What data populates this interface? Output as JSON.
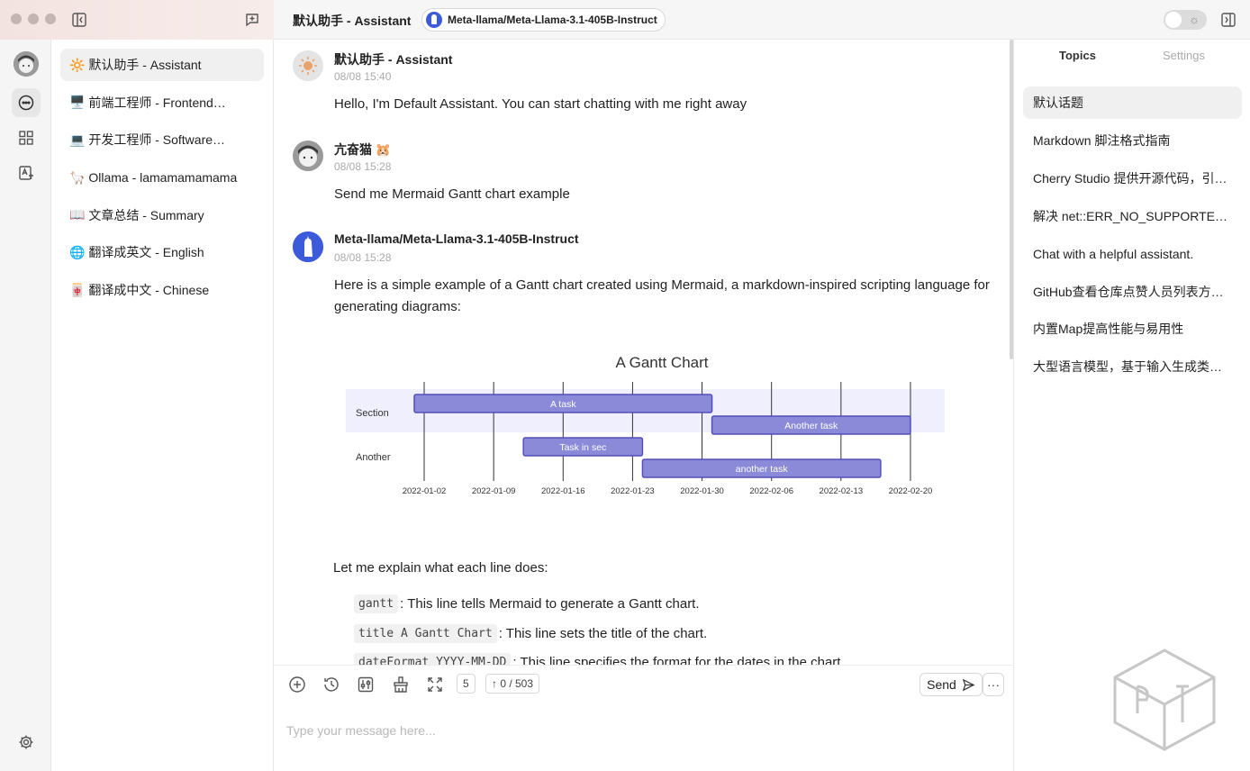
{
  "window": {
    "title": "默认助手 - Assistant",
    "model": "Meta-llama/Meta-Llama-3.1-405B-Instruct"
  },
  "assistants": [
    {
      "emoji": "🔆",
      "label": "默认助手 - Assistant"
    },
    {
      "emoji": "🖥️",
      "label": "前端工程师 - Frontend…"
    },
    {
      "emoji": "💻",
      "label": "开发工程师 - Software…"
    },
    {
      "emoji": "🦙",
      "label": "Ollama - lamamamamama"
    },
    {
      "emoji": "📖",
      "label": "文章总结 - Summary"
    },
    {
      "emoji": "🌐",
      "label": "翻译成英文 - English"
    },
    {
      "emoji": "🀄",
      "label": "翻译成中文 - Chinese"
    }
  ],
  "messages": [
    {
      "name": "默认助手 - Assistant",
      "time": "08/08 15:40",
      "text": "Hello, I'm Default Assistant. You can start chatting with me right away"
    },
    {
      "name": "亢奋猫 🐹",
      "time": "08/08 15:28",
      "text": "Send me Mermaid Gantt chart example"
    },
    {
      "name": "Meta-llama/Meta-Llama-3.1-405B-Instruct",
      "time": "08/08 15:28",
      "text": "Here is a simple example of a Gantt chart created using Mermaid, a markdown-inspired scripting language for generating diagrams:"
    }
  ],
  "chart_data": {
    "type": "gantt",
    "title": "A Gantt Chart",
    "sections": [
      "Section",
      "Another"
    ],
    "tasks": [
      {
        "section": "Section",
        "name": "A task",
        "start": "2022-01-01",
        "end": "2022-01-31"
      },
      {
        "section": "Section",
        "name": "Another task",
        "start": "2022-01-31",
        "end": "2022-02-20"
      },
      {
        "section": "Another",
        "name": "Task in sec",
        "start": "2022-01-12",
        "end": "2022-01-24"
      },
      {
        "section": "Another",
        "name": "another task",
        "start": "2022-01-24",
        "end": "2022-02-17"
      }
    ],
    "x_ticks": [
      "2022-01-02",
      "2022-01-09",
      "2022-01-16",
      "2022-01-23",
      "2022-01-30",
      "2022-02-06",
      "2022-02-13",
      "2022-02-20"
    ],
    "x_range": [
      "2022-01-01",
      "2022-02-20"
    ]
  },
  "explain": {
    "intro": "Let me explain what each line does:",
    "items": [
      {
        "code": "gantt",
        "text": ": This line tells Mermaid to generate a Gantt chart."
      },
      {
        "code": "title A Gantt Chart",
        "text": ": This line sets the title of the chart."
      },
      {
        "code": "dateFormat  YYYY-MM-DD",
        "text": ": This line specifies the format for the dates in the chart."
      }
    ]
  },
  "composer": {
    "context_count": "5",
    "token_count": "↑ 0 / 503",
    "send_label": "Send",
    "placeholder": "Type your message here..."
  },
  "right_panel": {
    "tabs": [
      "Topics",
      "Settings"
    ],
    "topics": [
      "默认话题",
      "Markdown 脚注格式指南",
      "Cherry Studio 提供开源代码，引…",
      "解决 net::ERR_NO_SUPPORTED…",
      "Chat with a helpful assistant.",
      "GitHub查看仓库点赞人员列表方…",
      "内置Map提高性能与易用性",
      "大型语言模型，基于输入生成类…"
    ]
  },
  "colors": {
    "bar_fill": "#8a8ad8",
    "bar_stroke": "#534fbc",
    "section_band": "#efeffd"
  }
}
